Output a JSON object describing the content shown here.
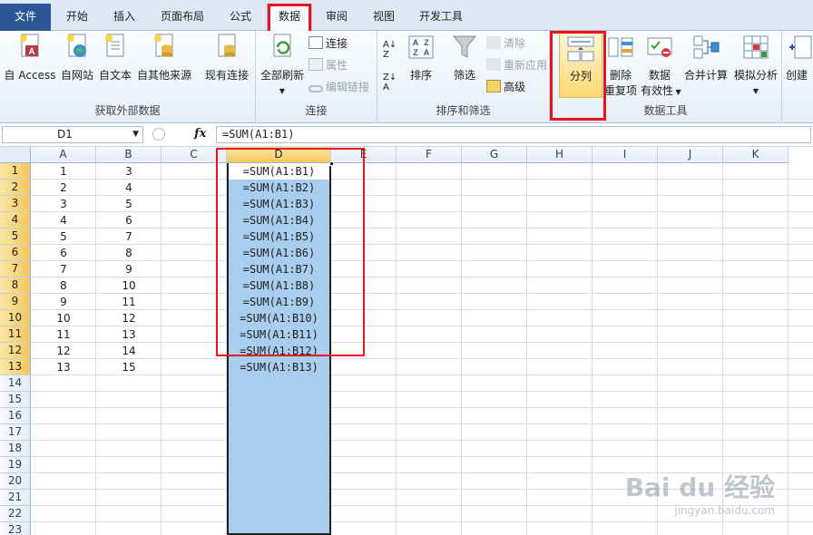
{
  "tabs": [
    "文件",
    "开始",
    "插入",
    "页面布局",
    "公式",
    "数据",
    "审阅",
    "视图",
    "开发工具"
  ],
  "active_tab": "数据",
  "ribbon": {
    "groups": {
      "external": {
        "label": "获取外部数据",
        "buttons": [
          "自 Access",
          "自网站",
          "自文本",
          "自其他来源",
          "现有连接"
        ]
      },
      "connections": {
        "label": "连接",
        "refresh": "全部刷新",
        "small": [
          "连接",
          "属性",
          "编辑链接"
        ]
      },
      "sort_filter": {
        "label": "排序和筛选",
        "sort": "排序",
        "filter": "筛选",
        "small": [
          "清除",
          "重新应用",
          "高级"
        ]
      },
      "data_tools": {
        "label": "数据工具",
        "split": "分列",
        "remove_dup_1": "删除",
        "remove_dup_2": "重复项",
        "validation_1": "数据",
        "validation_2": "有效性",
        "consolidate": "合并计算",
        "whatif": "模拟分析",
        "create": "创建"
      }
    }
  },
  "formula_bar": {
    "name_box": "D1",
    "fx": "fx",
    "formula": "=SUM(A1:B1)"
  },
  "columns": [
    "A",
    "B",
    "C",
    "D",
    "E",
    "F",
    "G",
    "H",
    "I",
    "J",
    "K"
  ],
  "rows": [
    "1",
    "2",
    "3",
    "4",
    "5",
    "6",
    "7",
    "8",
    "9",
    "10",
    "11",
    "12",
    "13",
    "14",
    "15",
    "16",
    "17",
    "18",
    "19",
    "20",
    "21",
    "22",
    "23"
  ],
  "col_a": [
    "1",
    "2",
    "3",
    "4",
    "5",
    "6",
    "7",
    "8",
    "9",
    "10",
    "11",
    "12",
    "13"
  ],
  "col_b": [
    "3",
    "4",
    "5",
    "6",
    "7",
    "8",
    "9",
    "10",
    "11",
    "12",
    "13",
    "14",
    "15"
  ],
  "col_d": [
    "=SUM(A1:B1)",
    "=SUM(A1:B2)",
    "=SUM(A1:B3)",
    "=SUM(A1:B4)",
    "=SUM(A1:B5)",
    "=SUM(A1:B6)",
    "=SUM(A1:B7)",
    "=SUM(A1:B8)",
    "=SUM(A1:B9)",
    "=SUM(A1:B10)",
    "=SUM(A1:B11)",
    "=SUM(A1:B12)",
    "=SUM(A1:B13)"
  ],
  "watermark": {
    "main": "Bai du 经验",
    "sub": "jingyan.baidu.com"
  },
  "colors": {
    "accent_red": "#e8141a",
    "selection": "#a8cdee",
    "file_tab": "#2b5797"
  }
}
